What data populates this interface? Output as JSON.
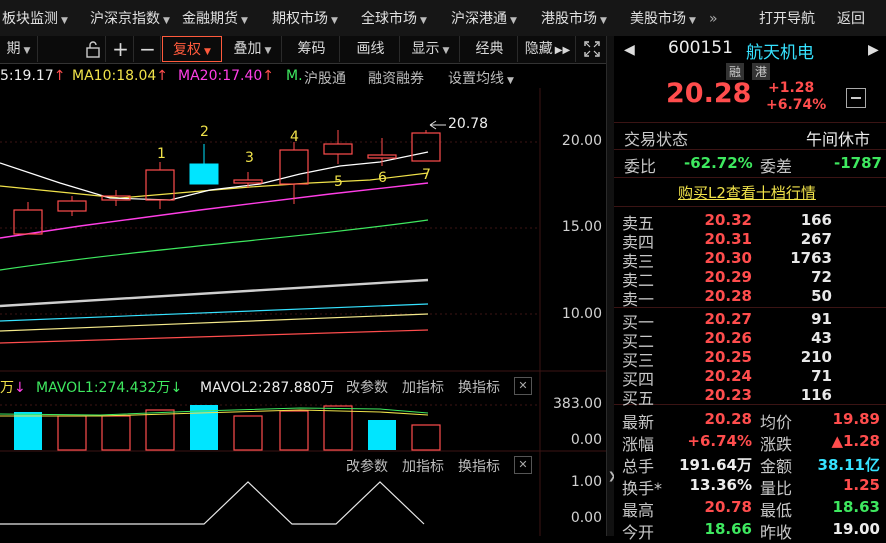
{
  "nav": {
    "items": [
      "板块监测",
      "沪深京指数",
      "金融期货",
      "期权市场",
      "全球市场",
      "沪深港通",
      "港股市场",
      "美股市场"
    ],
    "more": "»",
    "open_nav": "打开导航",
    "back": "返回"
  },
  "toolbar": {
    "period": "期",
    "plus": "+",
    "minus": "−",
    "restore": "复权",
    "overlay": "叠加",
    "chips": "筹码",
    "draw": "画线",
    "display": "显示",
    "classic": "经典",
    "hide": "隐藏"
  },
  "ma_legend": {
    "ma5": "5:19.17",
    "ma10": "MA10:18.04",
    "ma20": "MA20:17.40",
    "ma_more": "M.",
    "hsgt": "沪股通",
    "margin": "融资融券",
    "set_ma": "设置均线"
  },
  "chart": {
    "price_labels": [
      "20.00",
      "15.00",
      "10.00"
    ],
    "high_marker": "20.78",
    "candle_numbers": [
      "1",
      "2",
      "3",
      "4",
      "5",
      "6",
      "7"
    ],
    "vol_legend": {
      "prefix": "万",
      "mavol1": "MAVOL1:274.432万",
      "mavol2": "MAVOL2:287.880万",
      "change_param": "改参数",
      "add_indicator": "加指标",
      "switch_indicator": "换指标",
      "close": "✕"
    },
    "vol_labels": [
      "383.00",
      "0.00"
    ],
    "ind_legend": {
      "change_param": "改参数",
      "add_indicator": "加指标",
      "switch_indicator": "换指标",
      "close": "✕"
    },
    "ind_labels": [
      "1.00",
      "0.00"
    ],
    "colors": {
      "up": "#ff4d4d",
      "down": "#00e5ff",
      "ma5": "#ffffff",
      "ma10": "#f0e24a",
      "ma20": "#ff3ee6",
      "ma30": "#3ee85f",
      "ma60": "#cfcfcf",
      "ma120": "#36e2ff",
      "ma250": "#f4e88a"
    }
  },
  "quote": {
    "code": "600151",
    "name": "航天机电",
    "tags": [
      "融",
      "港"
    ],
    "price": "20.28",
    "change": "+1.28",
    "change_pct": "+6.74%",
    "trade_status_label": "交易状态",
    "trade_status": "午间休市",
    "weibi_label": "委比",
    "weibi": "-62.72%",
    "weicha_label": "委差",
    "weicha": "-1787",
    "l2_link": "购买L2查看十档行情",
    "asks": [
      {
        "label": "卖五",
        "price": "20.32",
        "vol": "166"
      },
      {
        "label": "卖四",
        "price": "20.31",
        "vol": "267"
      },
      {
        "label": "卖三",
        "price": "20.30",
        "vol": "1763"
      },
      {
        "label": "卖二",
        "price": "20.29",
        "vol": "72"
      },
      {
        "label": "卖一",
        "price": "20.28",
        "vol": "50"
      }
    ],
    "bids": [
      {
        "label": "买一",
        "price": "20.27",
        "vol": "91"
      },
      {
        "label": "买二",
        "price": "20.26",
        "vol": "43"
      },
      {
        "label": "买三",
        "price": "20.25",
        "vol": "210"
      },
      {
        "label": "买四",
        "price": "20.24",
        "vol": "71"
      },
      {
        "label": "买五",
        "price": "20.23",
        "vol": "116"
      }
    ],
    "stats": [
      {
        "l1": "最新",
        "v1": "20.28",
        "c1": "red",
        "l2": "均价",
        "v2": "19.89",
        "c2": "red"
      },
      {
        "l1": "涨幅",
        "v1": "+6.74%",
        "c1": "red",
        "l2": "涨跌",
        "v2": "▲1.28",
        "c2": "red"
      },
      {
        "l1": "总手",
        "v1": "191.64万",
        "c1": "white",
        "l2": "金额",
        "v2": "38.11亿",
        "c2": "cyan"
      },
      {
        "l1": "换手*",
        "v1": "13.36%",
        "c1": "white",
        "l2": "量比",
        "v2": "1.25",
        "c2": "red"
      },
      {
        "l1": "最高",
        "v1": "20.78",
        "c1": "red",
        "l2": "最低",
        "v2": "18.63",
        "c2": "green"
      },
      {
        "l1": "今开",
        "v1": "18.66",
        "c1": "green",
        "l2": "昨收",
        "v2": "19.00",
        "c2": "white"
      }
    ]
  }
}
